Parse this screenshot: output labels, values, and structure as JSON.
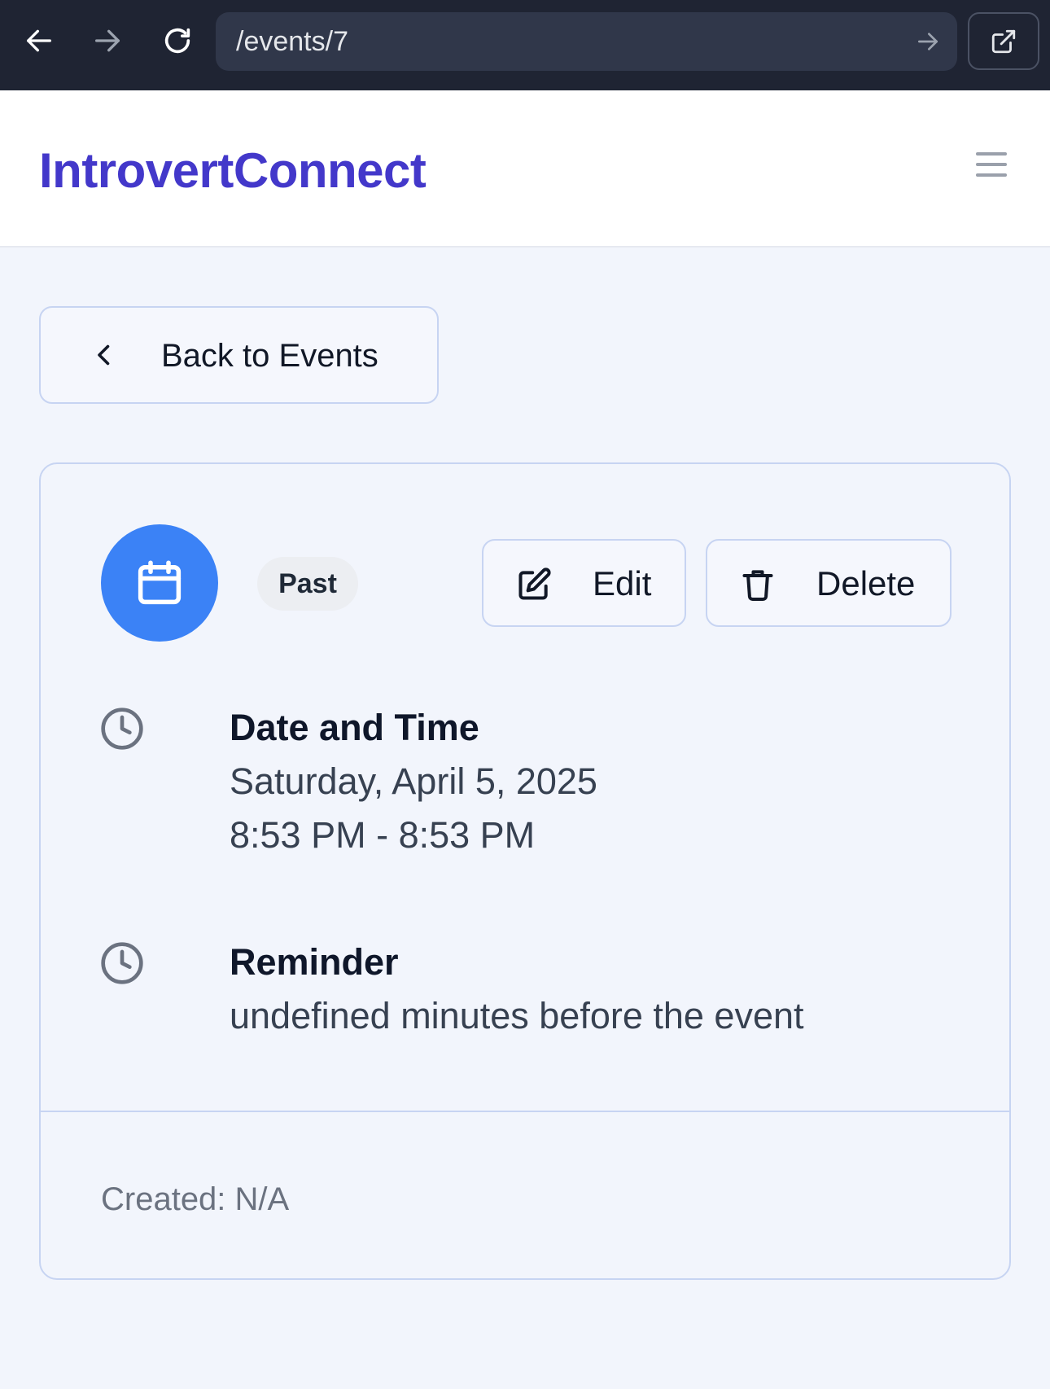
{
  "browser": {
    "url": "/events/7"
  },
  "header": {
    "logo": "IntrovertConnect"
  },
  "back_button": {
    "label": "Back to Events"
  },
  "event": {
    "status": "Past",
    "actions": {
      "edit_label": "Edit",
      "delete_label": "Delete"
    },
    "datetime": {
      "title": "Date and Time",
      "date": "Saturday, April 5, 2025",
      "time_range": "8:53 PM - 8:53 PM"
    },
    "reminder": {
      "title": "Reminder",
      "text": "undefined minutes before the event"
    },
    "created": "Created: N/A"
  },
  "icons": {
    "back": "arrow-left-icon",
    "forward": "arrow-right-icon",
    "reload": "reload-icon",
    "go": "arrow-right-icon",
    "external": "external-link-icon",
    "menu": "hamburger-menu-icon",
    "chevron": "chevron-left-icon",
    "calendar": "calendar-icon",
    "edit": "pencil-square-icon",
    "delete": "trash-icon",
    "clock": "clock-icon"
  },
  "colors": {
    "brand": "#4338ca",
    "accent": "#3b82f6",
    "page_background": "#f2f5fc",
    "browser_chrome": "#1f2433"
  }
}
